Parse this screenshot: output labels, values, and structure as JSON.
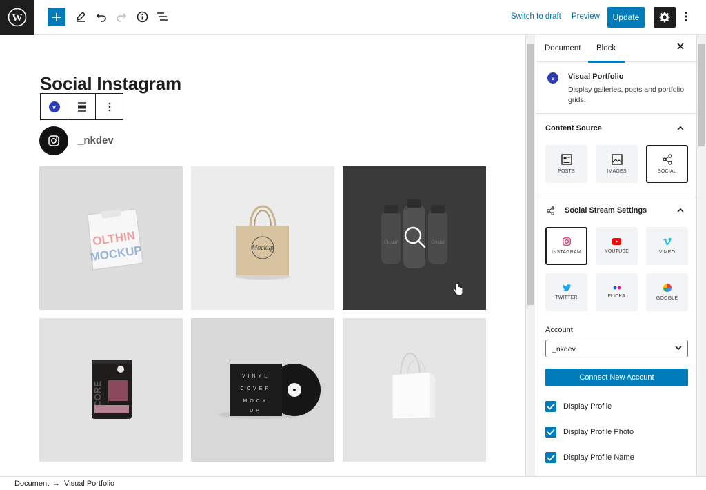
{
  "toolbar": {
    "switch_to_draft": "Switch to draft",
    "preview": "Preview",
    "update": "Update"
  },
  "editor": {
    "page_title": "Social Instagram",
    "profile_name": "_nkdev",
    "gallery_items": [
      {
        "name": "tshirt-mockup",
        "text": "OLTHIN MOCKUP"
      },
      {
        "name": "tote-bag-mockup",
        "text": "Mockup"
      },
      {
        "name": "milk-bottles-mockup",
        "text": "Cristal"
      },
      {
        "name": "coffee-pouch-mockup",
        "text": "CORE"
      },
      {
        "name": "vinyl-cover-mockup",
        "text": "VINYL COVER MOCK UP"
      },
      {
        "name": "shopping-bag-mockup",
        "text": ""
      }
    ]
  },
  "sidebar": {
    "tabs": [
      "Document",
      "Block"
    ],
    "active_tab": "Block",
    "block_name": "Visual Portfolio",
    "block_description": "Display galleries, posts and portfolio grids.",
    "content_source": {
      "title": "Content Source",
      "options": [
        {
          "label": "POSTS",
          "icon": "posts-icon"
        },
        {
          "label": "IMAGES",
          "icon": "images-icon"
        },
        {
          "label": "SOCIAL",
          "icon": "share-icon",
          "selected": true
        }
      ]
    },
    "social_stream": {
      "title": "Social Stream Settings",
      "options": [
        {
          "label": "INSTAGRAM",
          "icon": "instagram-icon",
          "color": "#e1306c",
          "selected": true
        },
        {
          "label": "YOUTUBE",
          "icon": "youtube-icon",
          "color": "#ff0000"
        },
        {
          "label": "VIMEO",
          "icon": "vimeo-icon",
          "color": "#1ab7ea"
        },
        {
          "label": "TWITTER",
          "icon": "twitter-icon",
          "color": "#1da1f2"
        },
        {
          "label": "FLICKR",
          "icon": "flickr-icon",
          "color": "#ff0084"
        },
        {
          "label": "GOOGLE",
          "icon": "google-icon",
          "color": "#4285f4"
        }
      ]
    },
    "account_label": "Account",
    "account_value": "_nkdev",
    "connect_button": "Connect New Account",
    "checkboxes": [
      {
        "label": "Display Profile",
        "checked": true
      },
      {
        "label": "Display Profile Photo",
        "checked": true
      },
      {
        "label": "Display Profile Name",
        "checked": true
      }
    ]
  },
  "footer": {
    "breadcrumb": [
      "Document",
      "Visual Portfolio"
    ],
    "separator": "→"
  },
  "colors": {
    "accent": "#007cba",
    "dark": "#1e1e1e",
    "vp_brand": "#2d3bb8"
  }
}
